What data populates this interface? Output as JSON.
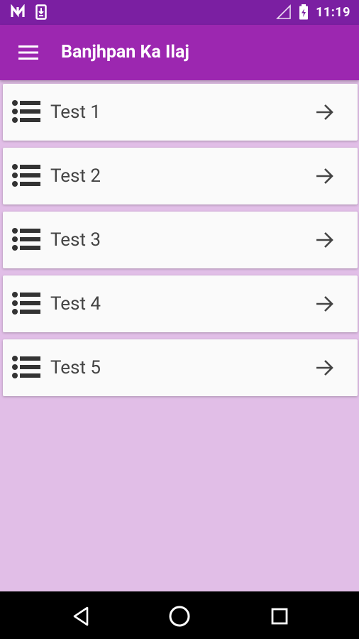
{
  "status_bar": {
    "time": "11:19",
    "icons": [
      "n-notification-icon",
      "download-notification-icon",
      "signal-icon",
      "battery-charging-icon"
    ]
  },
  "app_bar": {
    "title": "Banjhpan Ka Ilaj",
    "menu_icon": "hamburger-menu-icon"
  },
  "items": [
    {
      "label": "Test 1",
      "icon": "list-icon",
      "action_icon": "arrow-right-icon"
    },
    {
      "label": "Test 2",
      "icon": "list-icon",
      "action_icon": "arrow-right-icon"
    },
    {
      "label": "Test 3",
      "icon": "list-icon",
      "action_icon": "arrow-right-icon"
    },
    {
      "label": "Test 4",
      "icon": "list-icon",
      "action_icon": "arrow-right-icon"
    },
    {
      "label": "Test 5",
      "icon": "list-icon",
      "action_icon": "arrow-right-icon"
    }
  ],
  "nav_bar": {
    "buttons": [
      "back-icon",
      "home-icon",
      "recents-icon"
    ]
  },
  "colors": {
    "status_bar": "#7b1fa2",
    "app_bar": "#9c27b0",
    "background": "#e1bee7",
    "card": "#fafafa",
    "text": "#444444"
  }
}
